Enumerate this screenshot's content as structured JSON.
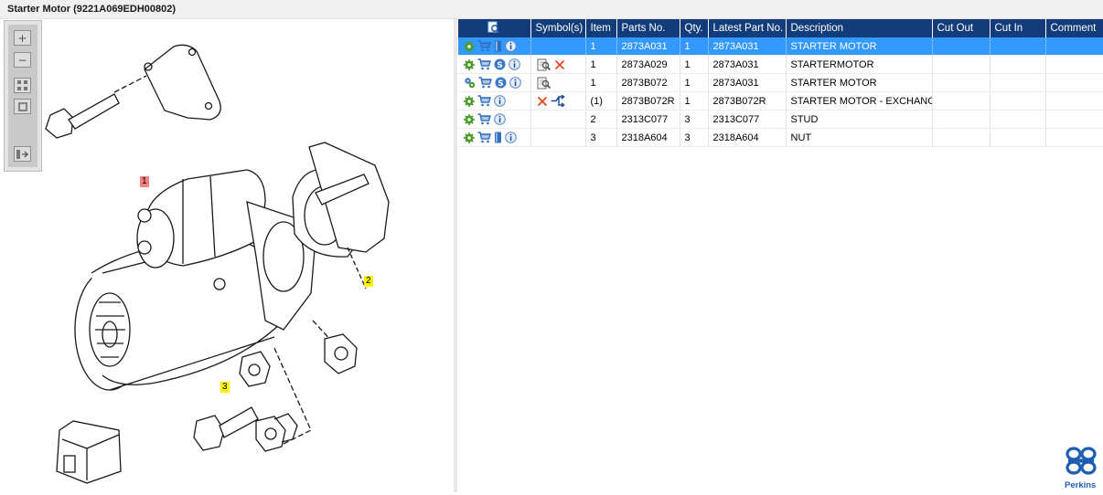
{
  "window": {
    "title": "Starter Motor (9221A069EDH00802)"
  },
  "toolbox": {
    "zoom_in_icon": "plus-icon",
    "zoom_out_icon": "minus-icon",
    "fit_icon": "fit-page-icon",
    "actual_size_icon": "actual-size-icon",
    "toggle_list_icon": "toggle-list-icon"
  },
  "diagram": {
    "callouts": [
      {
        "label": "1",
        "color": "#f48080"
      },
      {
        "label": "2",
        "color": "#f6f600"
      },
      {
        "label": "3",
        "color": "#f6f600"
      }
    ]
  },
  "table": {
    "header_icon": "search-page-icon",
    "columns": [
      "Symbol(s)",
      "Item",
      "Parts No.",
      "Qty.",
      "Latest Part No.",
      "Description",
      "Cut Out",
      "Cut In",
      "Comment"
    ],
    "header_bg": "#123d7a",
    "selected_bg": "#3399ff",
    "rows": [
      {
        "icons": [
          "gear-icon",
          "cart-icon",
          "book-icon",
          "info-icon"
        ],
        "symbols": [],
        "item": "1",
        "part_no": "2873A031",
        "qty": "1",
        "latest": "2873A031",
        "description": "STARTER MOTOR",
        "cut_out": "",
        "cut_in": "",
        "comment": "",
        "selected": true
      },
      {
        "icons": [
          "gear-icon",
          "cart-icon",
          "s-icon",
          "info-icon"
        ],
        "symbols": [
          "zoom-page-icon",
          "cross-icon"
        ],
        "item": "1",
        "part_no": "2873A029",
        "qty": "1",
        "latest": "2873A031",
        "description": "STARTERMOTOR",
        "cut_out": "",
        "cut_in": "",
        "comment": "",
        "selected": false
      },
      {
        "icons": [
          "gears-icon",
          "cart-icon",
          "s-icon",
          "info-icon"
        ],
        "symbols": [
          "zoom-page-icon"
        ],
        "item": "1",
        "part_no": "2873B072",
        "qty": "1",
        "latest": "2873A031",
        "description": "STARTER MOTOR",
        "cut_out": "",
        "cut_in": "",
        "comment": "",
        "selected": false
      },
      {
        "icons": [
          "gear-icon",
          "cart-icon",
          "info-icon"
        ],
        "symbols": [
          "cross-icon",
          "exchange-icon"
        ],
        "item": "(1)",
        "part_no": "2873B072R",
        "qty": "1",
        "latest": "2873B072R",
        "description": "STARTER MOTOR - EXCHANGE",
        "cut_out": "",
        "cut_in": "",
        "comment": "",
        "selected": false
      },
      {
        "icons": [
          "gear-icon",
          "cart-icon",
          "info-icon"
        ],
        "symbols": [],
        "item": "2",
        "part_no": "2313C077",
        "qty": "3",
        "latest": "2313C077",
        "description": "STUD",
        "cut_out": "",
        "cut_in": "",
        "comment": "",
        "selected": false
      },
      {
        "icons": [
          "gear-icon",
          "cart-icon",
          "book-icon",
          "info-icon"
        ],
        "symbols": [],
        "item": "3",
        "part_no": "2318A604",
        "qty": "3",
        "latest": "2318A604",
        "description": "NUT",
        "cut_out": "",
        "cut_in": "",
        "comment": "",
        "selected": false
      }
    ]
  },
  "brand": {
    "logo_text": "Perkins",
    "logo_icon": "perkins-logo-icon",
    "color": "#1d5eb3"
  }
}
